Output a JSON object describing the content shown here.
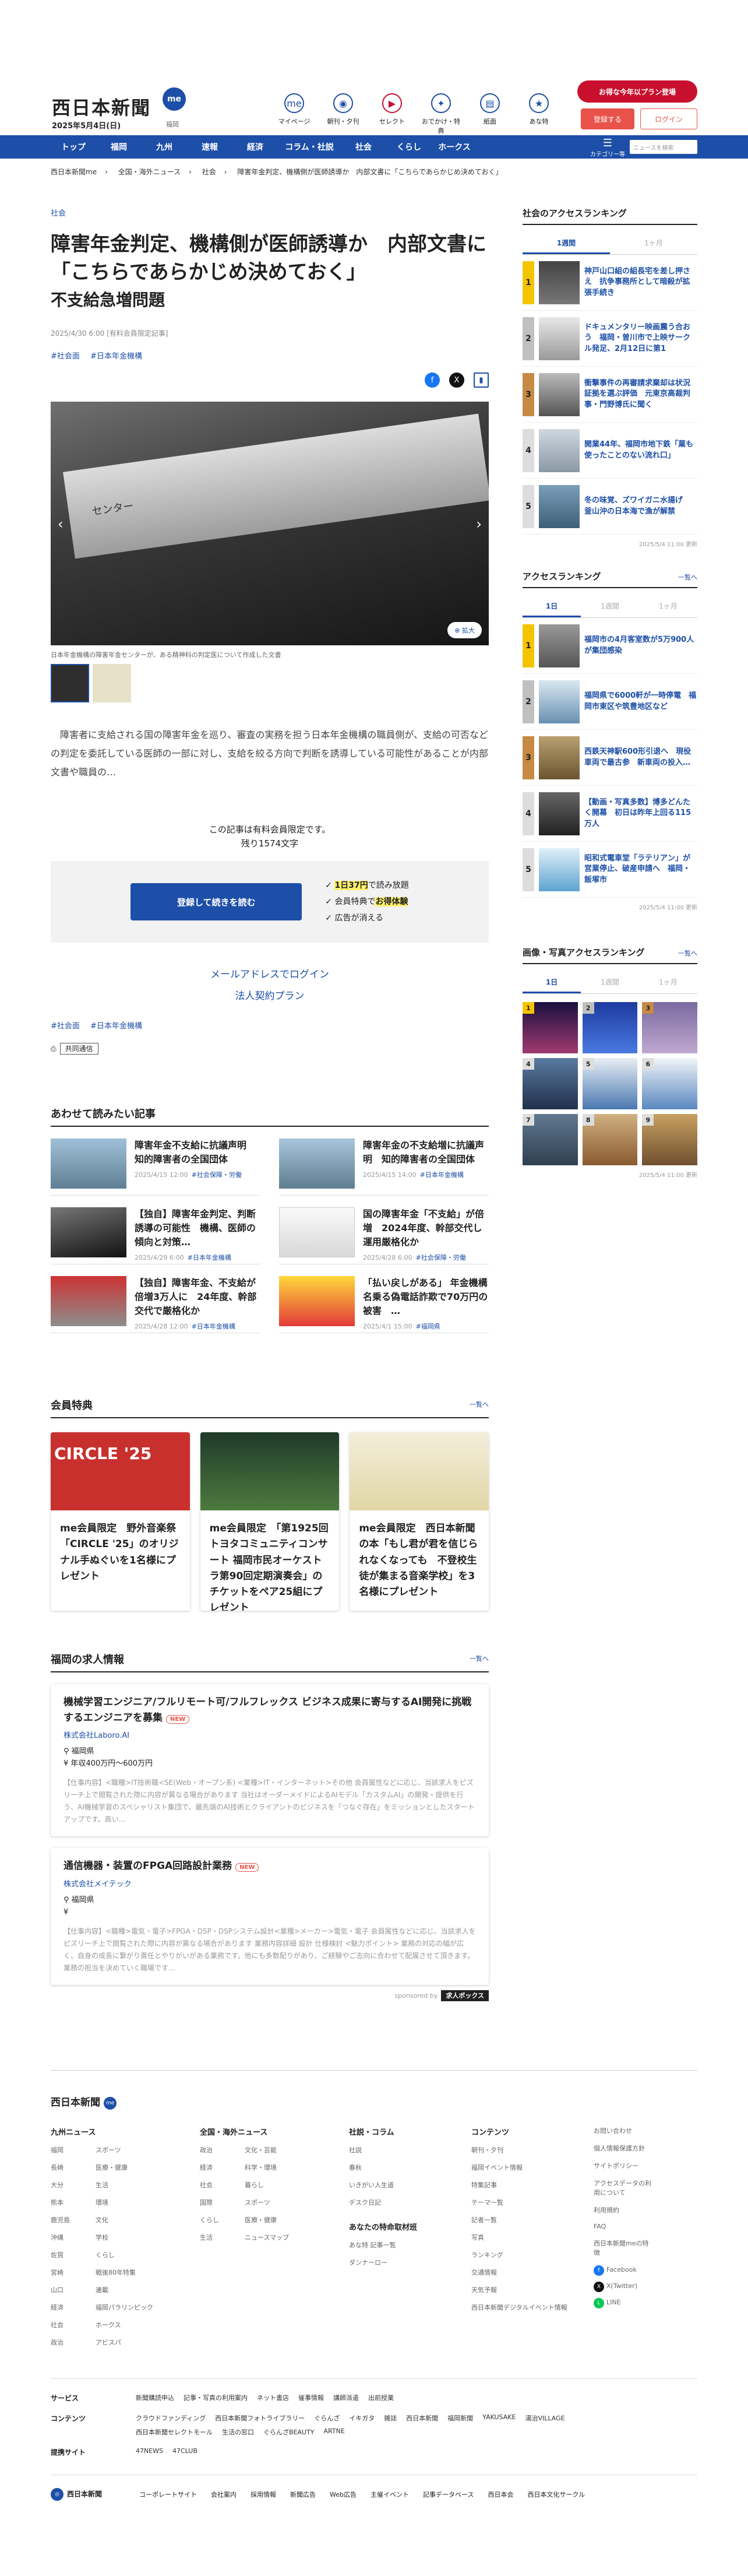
{
  "header": {
    "logo": "西日本新聞",
    "logo_badge": "me",
    "date": "2025年5月4日(日)",
    "region": "福岡",
    "icons": [
      {
        "label": "マイページ",
        "glyph": "me",
        "icon": "mypage-icon"
      },
      {
        "label": "朝刊・夕刊",
        "glyph": "◉",
        "icon": "newspaper-icon"
      },
      {
        "label": "セレクト",
        "glyph": "▶",
        "icon": "select-icon"
      },
      {
        "label": "おでかけ・特典",
        "glyph": "✦",
        "icon": "benefit-icon"
      },
      {
        "label": "紙面",
        "glyph": "▤",
        "icon": "paper-icon"
      },
      {
        "label": "あな特",
        "glyph": "★",
        "icon": "anatoku-icon"
      }
    ],
    "promo": "お得な今年以プラン登場",
    "register": "登録する",
    "login": "ログイン"
  },
  "nav": {
    "items": [
      "トップ",
      "福岡",
      "九州",
      "速報",
      "経済",
      "コラム・社説",
      "社会",
      "くらし",
      "ホークス"
    ],
    "menu": "カテゴリー等",
    "search_placeholder": "ニュースを検索"
  },
  "breadcrumb": [
    "西日本新聞me",
    "全国・海外ニュース",
    "社会",
    "障害年金判定、機構側が医師誘導か　内部文書に「こちらであらかじめ決めておく」"
  ],
  "article": {
    "category": "社会",
    "title": "障害年金判定、機構側が医師誘導か　内部文書に「こちらであらかじめ決めておく」",
    "subtitle": "不支給急増問題",
    "date": "2025/4/30 6:00 [有料会員限定記事]",
    "tags": [
      "#社会面",
      "#日本年金機構"
    ],
    "photo_paper_text": "センター",
    "zoom": "拡大",
    "caption": "日本年金機構の障害年金センターが、ある精神科の判定医について作成した文書",
    "lead": "　障害者に支給される国の障害年金を巡り、審査の実務を担う日本年金機構の職員側が、支給の可否などの判定を委託している医師の一部に対し、支給を絞る方向で判断を誘導している可能性があることが内部文書や職員の…",
    "paywall_note_1": "この記事は有料会員限定です。",
    "paywall_note_2": "残り1574文字",
    "paywall_button": "登録して続きを読む",
    "benefit_1a": "1日37円",
    "benefit_1b": "で読み放題",
    "benefit_2a": "会員特典で",
    "benefit_2b": "お得体験",
    "benefit_3": "広告が消える",
    "login_link": "メールアドレスでログイン",
    "plan_link": "法人契約プラン",
    "tags_bottom": [
      "#社会面",
      "#日本年金機構"
    ],
    "source": "共同通信"
  },
  "related": {
    "title": "あわせて読みたい記事",
    "items": [
      {
        "title": "障害年金不支給に抗議声明　知的障害者の全国団体",
        "date": "2025/4/15 12:00",
        "tag": "#社会保障・労働"
      },
      {
        "title": "障害年金の不支給増に抗議声明　知的障害者の全国団体",
        "date": "2025/4/15 14:00",
        "tag": "#日本年金機構"
      },
      {
        "title": "【独自】障害年金判定、判断誘導の可能性　機構、医師の傾向と対策…",
        "date": "2025/4/29 6:00",
        "tag": "#日本年金機構"
      },
      {
        "title": "国の障害年金「不支給」が倍増　2024年度、幹部交代し運用厳格化か",
        "date": "2025/4/28 6:00",
        "tag": "#社会保障・労働"
      },
      {
        "title": "【独自】障害年金、不支給が倍増3万人に　24年度、幹部交代で厳格化か",
        "date": "2025/4/28 12:00",
        "tag": "#日本年金機構"
      },
      {
        "title": "「払い戻しがある」 年金機構名乗る偽電話詐欺で70万円の被害　…",
        "date": "2025/4/1 15:00",
        "tag": "#福岡県"
      }
    ]
  },
  "benefits": {
    "title": "会員特典",
    "more": "一覧へ",
    "banner_1": "CIRCLE '25",
    "items": [
      {
        "title": "me会員限定　野外音楽祭「CIRCLE '25」のオリジナル手ぬぐいを1名様にプレゼント"
      },
      {
        "title": "me会員限定　「第1925回トヨタコミュニティコンサート 福岡市民オーケストラ第90回定期演奏会」のチケットをペア25組にプレゼント"
      },
      {
        "title": "me会員限定　西日本新聞の本「もし君が君を信じられなくなっても　不登校生徒が集まる音楽学校」を3名様にプレゼント"
      }
    ]
  },
  "jobs": {
    "title": "福岡の求人情報",
    "more": "一覧へ",
    "new_label": "NEW",
    "items": [
      {
        "title": "機械学習エンジニア/フルリモート可/フルフレックス ビジネス成果に寄与するAI開発に挑戦するエンジニアを募集",
        "company": "株式会社Laboro.AI",
        "location": "福岡県",
        "salary": "年収400万円〜600万円",
        "desc": "【仕事内容】<職種>IT技術職<SE(Web・オープン系) <業種>IT・インターネット>その他 会員属性などに応じ、当該求人をピズリーチ上で閲覧された際に内容が異なる場合があります 当社はオーダーメイドによるAIモデル「カスタムAI」の開発・提供を行う、AI機械学習のスペシャリスト集団で、最先端のAI技術とクライアントのビジネスを「つなぐ存在」をミッションとしたスタートアップです。高い…"
      },
      {
        "title": "通信機器・装置のFPGA回路設計業務",
        "company": "株式会社メイテック",
        "location": "福岡県",
        "salary": "",
        "desc": "【仕事内容】<職種>電気・電子>FPGA・DSP・DSPシステム設計<業種>メーカー>電気・電子 会員属性などに応じ、当該求人をピズリーチ上で閲覧された際に内容が異なる場合があります 業務内容詳細 設計 仕様検討 <魅力ポイント> 業務の対応の幅が広く、自身の成長に繋がり責任とやりがいがある業務です。他にも多数配りがあり、ご経験やご志向に合わせて配属させて頂きます。業務の担当を決めていく職場です…"
      }
    ],
    "sponsor_label": "sponsored by",
    "sponsor": "求人ボックス"
  },
  "sidebar": {
    "access_social": {
      "title": "社会のアクセスランキング",
      "tabs": [
        "1週間",
        "1ヶ月"
      ],
      "items": [
        "神戸山口組の組長宅を差し押さえ　抗争事務所として暗殺が拡張手続き",
        "ドキュメンタリー映画震う合おう　福岡・曽川市で上映サークル発足、2月12日に第1",
        "衝撃事件の再審請求棄却は状況証拠を選ぶ評価　元東京高裁判事・門野博氏に聞く",
        "開業44年、福岡市地下鉄「菓も使ったことのない流れ口」",
        "冬の味覚、ズワイガニ水揚げ　釜山沖の日本海で漁が解禁"
      ],
      "stamp": "2025/5/4 11:00 更新"
    },
    "access": {
      "title": "アクセスランキング",
      "more": "一覧へ",
      "tabs": [
        "1日",
        "1週間",
        "1ヶ月"
      ],
      "items": [
        "福岡市の4月客室数が5万900人が集団感染",
        "福岡県で6000軒が一時停電　福岡市東区や筑豊地区など",
        "西鉄天神駅600形引退へ　現役車両で最古参　新車両の投入…",
        "【動画・写真多数】博多どんたく開幕　初日は昨年上回る115万人",
        "昭和式電車堂「ラテリアン」が営業停止、破産申請へ　福岡・飯塚市"
      ],
      "stamp": "2025/5/4 11:00 更新"
    },
    "photo": {
      "title": "画像・写真アクセスランキング",
      "more": "一覧へ",
      "tabs": [
        "1日",
        "1週間",
        "1ヶ月"
      ],
      "stamp": "2025/5/4 11:00 更新"
    }
  },
  "footer": {
    "logo": "西日本新聞",
    "badge": "me",
    "columns": [
      {
        "title": "九州ニュース",
        "items": [
          "福岡",
          "長崎",
          "大分",
          "熊本",
          "鹿児島",
          "沖縄",
          "佐賀",
          "宮崎",
          "山口",
          "経済",
          "社会",
          "政治",
          "スポーツ",
          "医療・健康",
          "生活",
          "環境",
          "文化",
          "学校",
          "くらし",
          "戦後80年特集",
          "連載",
          "福岡パラリンピック",
          "ホークス",
          "アビスパ"
        ]
      },
      {
        "title": "全国・海外ニュース",
        "items": [
          "政治",
          "経済",
          "社会",
          "国際",
          "くらし",
          "生活",
          "文化・芸能",
          "科学・環境",
          "暮らし",
          "スポーツ",
          "医療・健康",
          "ニュースマップ"
        ]
      },
      {
        "title": "社説・コラム",
        "items": [
          "社説",
          "春秋",
          "いきがい人生道",
          "デスク日記"
        ],
        "title2": "あなたの特命取材班",
        "items2": [
          "あな特 記事一覧",
          "ダンナーロー"
        ]
      },
      {
        "title": "コンテンツ",
        "items": [
          "朝刊・夕刊",
          "福岡イベント情報",
          "特集記事",
          "テーマ一覧",
          "記者一覧",
          "写真",
          "ランキング",
          "交通情報",
          "天気予報",
          "西日本新聞デジタルイベント情報"
        ]
      },
      {
        "title": "",
        "items": [
          "お問い合わせ",
          "個人情報保護方針",
          "サイトポリシー",
          "アクセスデータの利用について",
          "利用規約",
          "FAQ",
          "西日本新聞meの特徴"
        ]
      }
    ],
    "social": [
      "Facebook",
      "X(Twitter)",
      "LINE"
    ],
    "link_rows": [
      {
        "label": "サービス",
        "items": [
          "新聞購読申込",
          "記事・写真の利用案内",
          "ネット書店",
          "催事情報",
          "講師派遣",
          "出前授業"
        ]
      },
      {
        "label": "コンテンツ",
        "items": [
          "クラウドファンディング",
          "西日本新聞フォトライブラリー",
          "ぐらんざ",
          "イキガタ",
          "雑誌",
          "西日本新聞",
          "福岡新聞",
          "YAKUSAKE",
          "湯治VILLAGE",
          "西日本新聞セレクトモール",
          "生活の窓口",
          "ぐらんざBEAUTY",
          "ARTNE"
        ]
      },
      {
        "label": "提携サイト",
        "items": [
          "47NEWS",
          "47CLUB"
        ]
      }
    ],
    "corp": "西日本新聞",
    "bottom": [
      "コーポレートサイト",
      "会社案内",
      "採用情報",
      "新聞広告",
      "Web広告",
      "主催イベント",
      "記事データベース",
      "西日本会",
      "西日本文化サークル"
    ]
  }
}
